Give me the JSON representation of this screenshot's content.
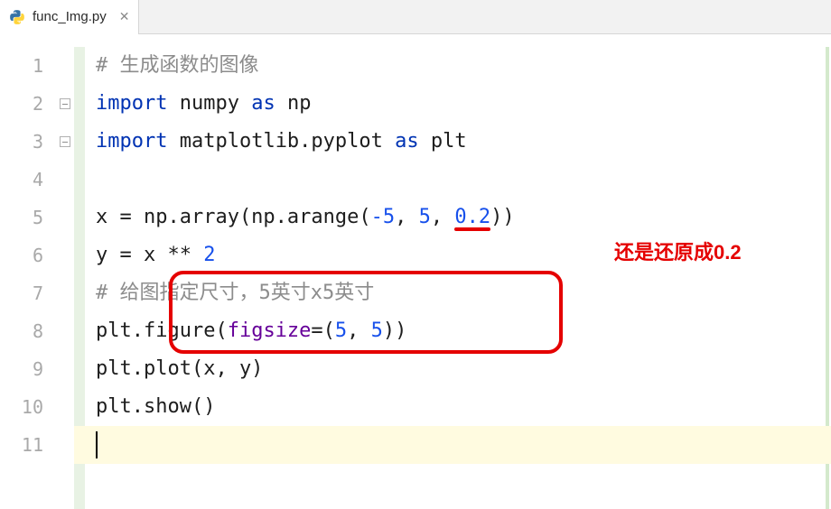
{
  "tab": {
    "filename": "func_Img.py"
  },
  "gutter": {
    "numbers": [
      "1",
      "2",
      "3",
      "4",
      "5",
      "6",
      "7",
      "8",
      "9",
      "10",
      "11"
    ]
  },
  "code": {
    "line1_comment": "# 生成函数的图像",
    "line2_kw1": "import",
    "line2_mod": " numpy ",
    "line2_kw2": "as",
    "line2_alias": " np",
    "line3_kw1": "import",
    "line3_mod": " matplotlib.pyplot ",
    "line3_kw2": "as",
    "line3_alias": " plt",
    "line5_a": "x = np.array(np.arange(",
    "line5_n1": "-5",
    "line5_s1": ", ",
    "line5_n2": "5",
    "line5_s2": ", ",
    "line5_n3": "0.2",
    "line5_b": "))",
    "line6_a": "y = x ** ",
    "line6_n": "2",
    "line7_comment": "# 给图指定尺寸，5英寸x5英寸",
    "line8_a": "plt.figure(",
    "line8_kwarg": "figsize",
    "line8_eq": "=(",
    "line8_n1": "5",
    "line8_s": ", ",
    "line8_n2": "5",
    "line8_b": "))",
    "line9": "plt.plot(x, y)",
    "line10": "plt.show()"
  },
  "annotation": {
    "text": "还是还原成0.2"
  }
}
